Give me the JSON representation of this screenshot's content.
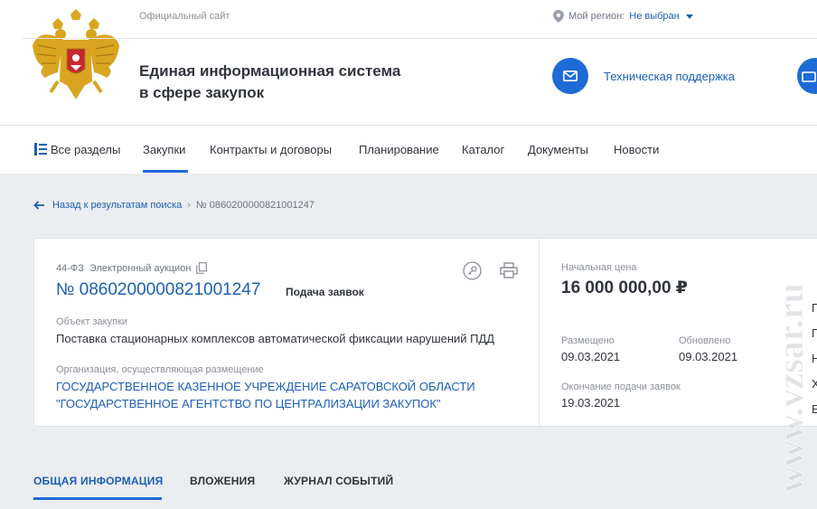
{
  "header": {
    "official_site": "Официальный сайт",
    "region_label": "Мой регион:",
    "region_value": "Не выбран",
    "title_line1": "Единая информационная система",
    "title_line2": "в сфере закупок",
    "support_label": "Техническая поддержка"
  },
  "nav": {
    "items": [
      {
        "label": "Все разделы"
      },
      {
        "label": "Закупки"
      },
      {
        "label": "Контракты и договоры"
      },
      {
        "label": "Планирование"
      },
      {
        "label": "Каталог"
      },
      {
        "label": "Документы"
      },
      {
        "label": "Новости"
      }
    ],
    "active": "Закупки"
  },
  "breadcrumb": {
    "back": "Назад к результатам поиска",
    "separator": "›",
    "current": "№ 0860200000821001247"
  },
  "purchase": {
    "law": "44-ФЗ",
    "method": "Электронный аукцион",
    "number": "№ 0860200000821001247",
    "status": "Подача заявок",
    "object_label": "Объект закупки",
    "object_value": "Поставка стационарных комплексов автоматической фиксации нарушений ПДД",
    "org_label": "Организация, осуществляющая размещение",
    "org_line1": "ГОСУДАРСТВЕННОЕ КАЗЕННОЕ УЧРЕЖДЕНИЕ САРАТОВСКОЙ ОБЛАСТИ",
    "org_line2": "\"ГОСУДАРСТВЕННОЕ АГЕНТСТВО ПО ЦЕНТРАЛИЗАЦИИ ЗАКУПОК\"",
    "price_label": "Начальная цена",
    "price_value": "16 000 000,00 ₽",
    "posted_label": "Размещено",
    "posted_value": "09.03.2021",
    "updated_label": "Обновлено",
    "updated_value": "09.03.2021",
    "deadline_label": "Окончание подачи заявок",
    "deadline_value": "19.03.2021"
  },
  "side_cutoff": [
    "П",
    "П",
    "Н",
    "Х",
    "Е"
  ],
  "tabs": [
    {
      "label": "ОБЩАЯ ИНФОРМАЦИЯ"
    },
    {
      "label": "ВЛОЖЕНИЯ"
    },
    {
      "label": "ЖУРНАЛ СОБЫТИЙ"
    }
  ],
  "watermark": "www.vzsar.ru",
  "colors": {
    "accent": "#1c6bd6",
    "link": "#1c5fb5",
    "background": "#ebedf0",
    "emblem_gold": "#d9a520",
    "emblem_red": "#c8282d"
  },
  "icons": {
    "region": "map-pin-icon",
    "support": "envelope-icon",
    "menu": "grid-menu-icon",
    "back": "arrow-left-icon",
    "copy": "copy-icon",
    "key": "key-icon",
    "print": "printer-icon"
  }
}
